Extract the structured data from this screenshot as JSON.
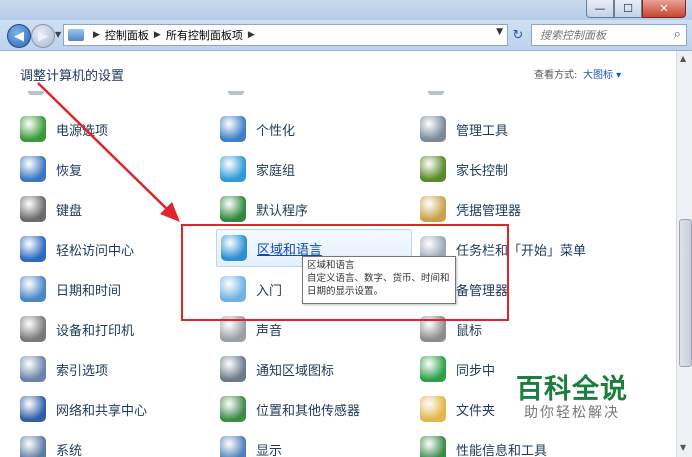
{
  "window": {
    "minimize": "—",
    "maximize": "☐",
    "close": "✕"
  },
  "nav": {
    "breadcrumb": [
      "控制面板",
      "所有控制面板项"
    ],
    "search_placeholder": "搜索控制面板"
  },
  "header": {
    "title": "调整计算机的设置",
    "view_by_label": "查看方式:",
    "view_by_value": "大图标 ▾"
  },
  "items": [
    {
      "label": "电源选项",
      "icon": "power-icon",
      "color": "#3a9a3a"
    },
    {
      "label": "个性化",
      "icon": "personalization-icon",
      "color": "#3f7fc8"
    },
    {
      "label": "管理工具",
      "icon": "admin-tools-icon",
      "color": "#7a8a9a"
    },
    {
      "label": "恢复",
      "icon": "recovery-icon",
      "color": "#3b78c4"
    },
    {
      "label": "家庭组",
      "icon": "homegroup-icon",
      "color": "#2f9bd6"
    },
    {
      "label": "家长控制",
      "icon": "parental-controls-icon",
      "color": "#5a8a2a"
    },
    {
      "label": "键盘",
      "icon": "keyboard-icon",
      "color": "#6b6b6b"
    },
    {
      "label": "默认程序",
      "icon": "default-programs-icon",
      "color": "#2f8a3f"
    },
    {
      "label": "凭据管理器",
      "icon": "credential-manager-icon",
      "color": "#c9a24a"
    },
    {
      "label": "轻松访问中心",
      "icon": "ease-of-access-icon",
      "color": "#2d6ac0"
    },
    {
      "label": "区域和语言",
      "icon": "region-language-icon",
      "color": "#2c8fd0"
    },
    {
      "label": "任务栏和「开始」菜单",
      "icon": "taskbar-icon",
      "color": "#9aa6b5"
    },
    {
      "label": "日期和时间",
      "icon": "date-time-icon",
      "color": "#4a86c8"
    },
    {
      "label": "入门",
      "icon": "getting-started-icon",
      "color": "#6fb1e0"
    },
    {
      "label": "备管理器",
      "icon": "device-manager-icon",
      "color": "#8895a5"
    },
    {
      "label": "设备和打印机",
      "icon": "devices-printers-icon",
      "color": "#7a7a7a"
    },
    {
      "label": "声音",
      "icon": "sound-icon",
      "color": "#9aa0a8"
    },
    {
      "label": "鼠标",
      "icon": "mouse-icon",
      "color": "#8c8c8c"
    },
    {
      "label": "索引选项",
      "icon": "indexing-icon",
      "color": "#6a84a8"
    },
    {
      "label": "通知区域图标",
      "icon": "notification-area-icon",
      "color": "#6b7b8c"
    },
    {
      "label": "同步中",
      "icon": "sync-center-icon",
      "color": "#2fa04a"
    },
    {
      "label": "网络和共享中心",
      "icon": "network-sharing-icon",
      "color": "#2f5fa8"
    },
    {
      "label": "位置和其他传感器",
      "icon": "location-sensors-icon",
      "color": "#3f8a4a"
    },
    {
      "label": "文件夹",
      "icon": "folder-options-icon",
      "color": "#e3b54a"
    },
    {
      "label": "系统",
      "icon": "system-icon",
      "color": "#5a7aa0"
    },
    {
      "label": "显示",
      "icon": "display-icon",
      "color": "#4f7fb8"
    },
    {
      "label": "性能信息和工具",
      "icon": "performance-icon",
      "color": "#3a8a4a"
    }
  ],
  "tooltip": {
    "title": "区域和语言",
    "body": "自定义语言、数字、货币、时间和日期的显示设置。"
  },
  "watermark": {
    "brand": "百科全说",
    "tagline": "助你轻松解决"
  }
}
